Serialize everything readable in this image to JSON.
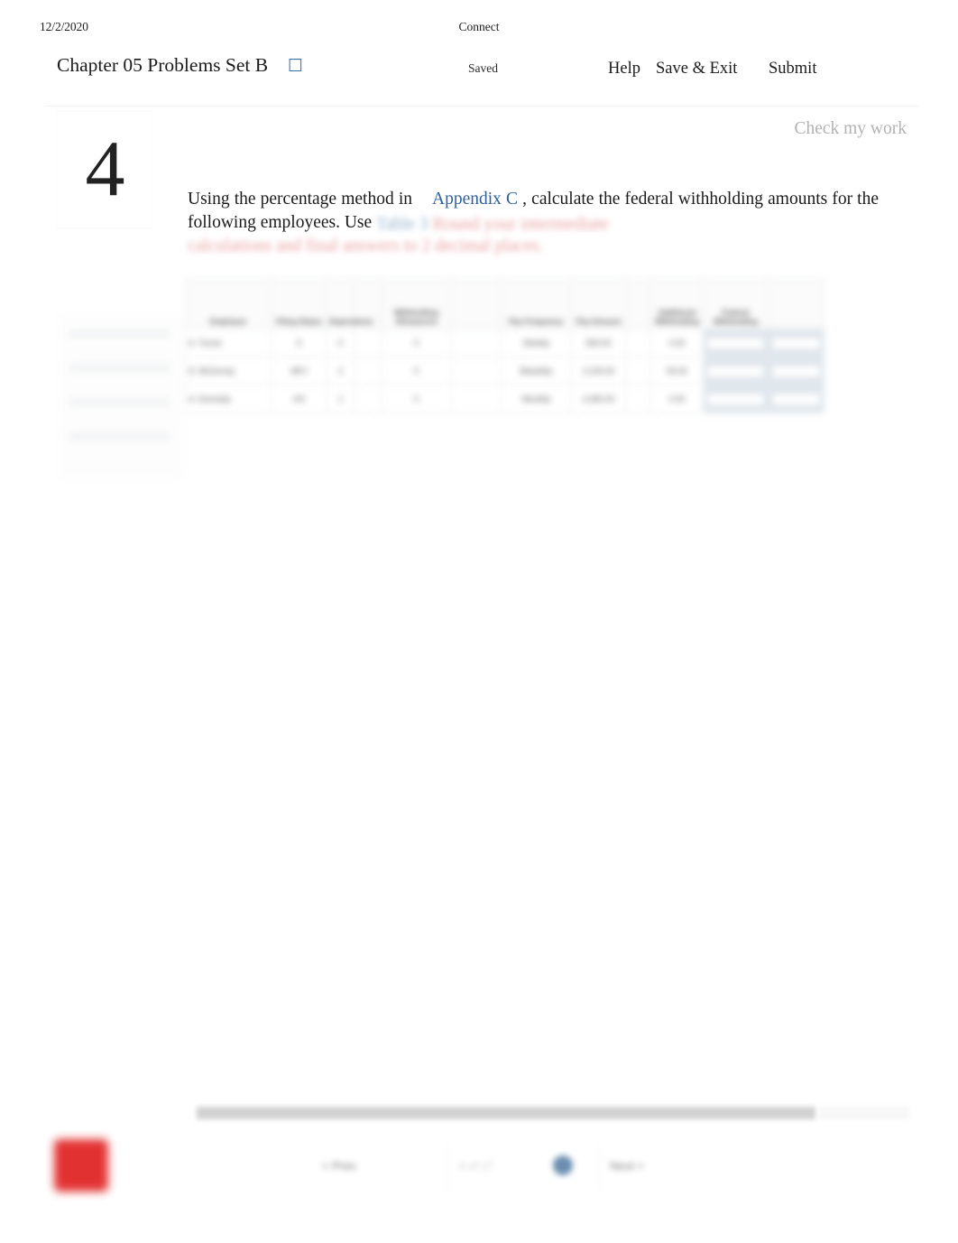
{
  "print_header": {
    "date": "12/2/2020",
    "title": "Connect"
  },
  "assignment_bar": {
    "title": "Chapter 05 Problems Set B",
    "info_icon": "info-icon-glyph",
    "save_status": "Saved",
    "help_label": "Help",
    "save_exit_label": "Save & Exit",
    "submit_label": "Submit",
    "submit_color": "#2f6198"
  },
  "question": {
    "number": "4",
    "check_my_work_label": "Check my work",
    "prompt_part1": "Using the percentage method in",
    "prompt_link": "Appendix C",
    "prompt_part2": ", calculate the federal withholding amounts for the following employees. Use",
    "prompt_blurred_blue": "Table 3",
    "prompt_blurred_red_1": "Round your intermediate",
    "prompt_blurred_red_2": "calculations and final answers to 2 decimal places.",
    "link_color": "#2f6198",
    "note_color": "#d33d3d"
  },
  "answer_table": {
    "headers": [
      "Employee",
      "Filing Status",
      "Dependents",
      "",
      "Withholding Allowances",
      "",
      "Pay Frequency",
      "Pay Amount",
      "",
      "Additional Withholding",
      "Federal Withholding",
      ""
    ],
    "rows": [
      {
        "employee": "S. Turner",
        "filing_status": "S",
        "dependents": "0",
        "dependents2": "",
        "withholding": "0",
        "withholding2": "",
        "pay_frequency": "Weekly",
        "pay_amount": "825.00",
        "per": "",
        "additional": "0.00",
        "answer1": "",
        "answer2": ""
      },
      {
        "employee": "D. McGorray",
        "filing_status": "MFJ",
        "dependents": "2",
        "dependents2": "",
        "withholding": "0",
        "withholding2": "",
        "pay_frequency": "Biweekly",
        "pay_amount": "2,100.00",
        "per": "",
        "additional": "50.00",
        "answer1": "",
        "answer2": ""
      },
      {
        "employee": "A. Kennedy",
        "filing_status": "HH",
        "dependents": "1",
        "dependents2": "",
        "withholding": "0",
        "withholding2": "",
        "pay_frequency": "Monthly",
        "pay_amount": "4,350.00",
        "per": "",
        "additional": "0.00",
        "answer1": "",
        "answer2": ""
      }
    ],
    "answer_cell_bg": "#dde5ec"
  },
  "rail_panel": {
    "items": [
      "eBook",
      "References",
      "Print",
      "Hint"
    ]
  },
  "footer": {
    "prev_label": "< Prev",
    "position_label": "4 of 17",
    "next_label": "Next >",
    "accent_color": "#5b82a8",
    "brand_logo": "mcgraw-hill-logo",
    "brand_color": "#e02020"
  }
}
